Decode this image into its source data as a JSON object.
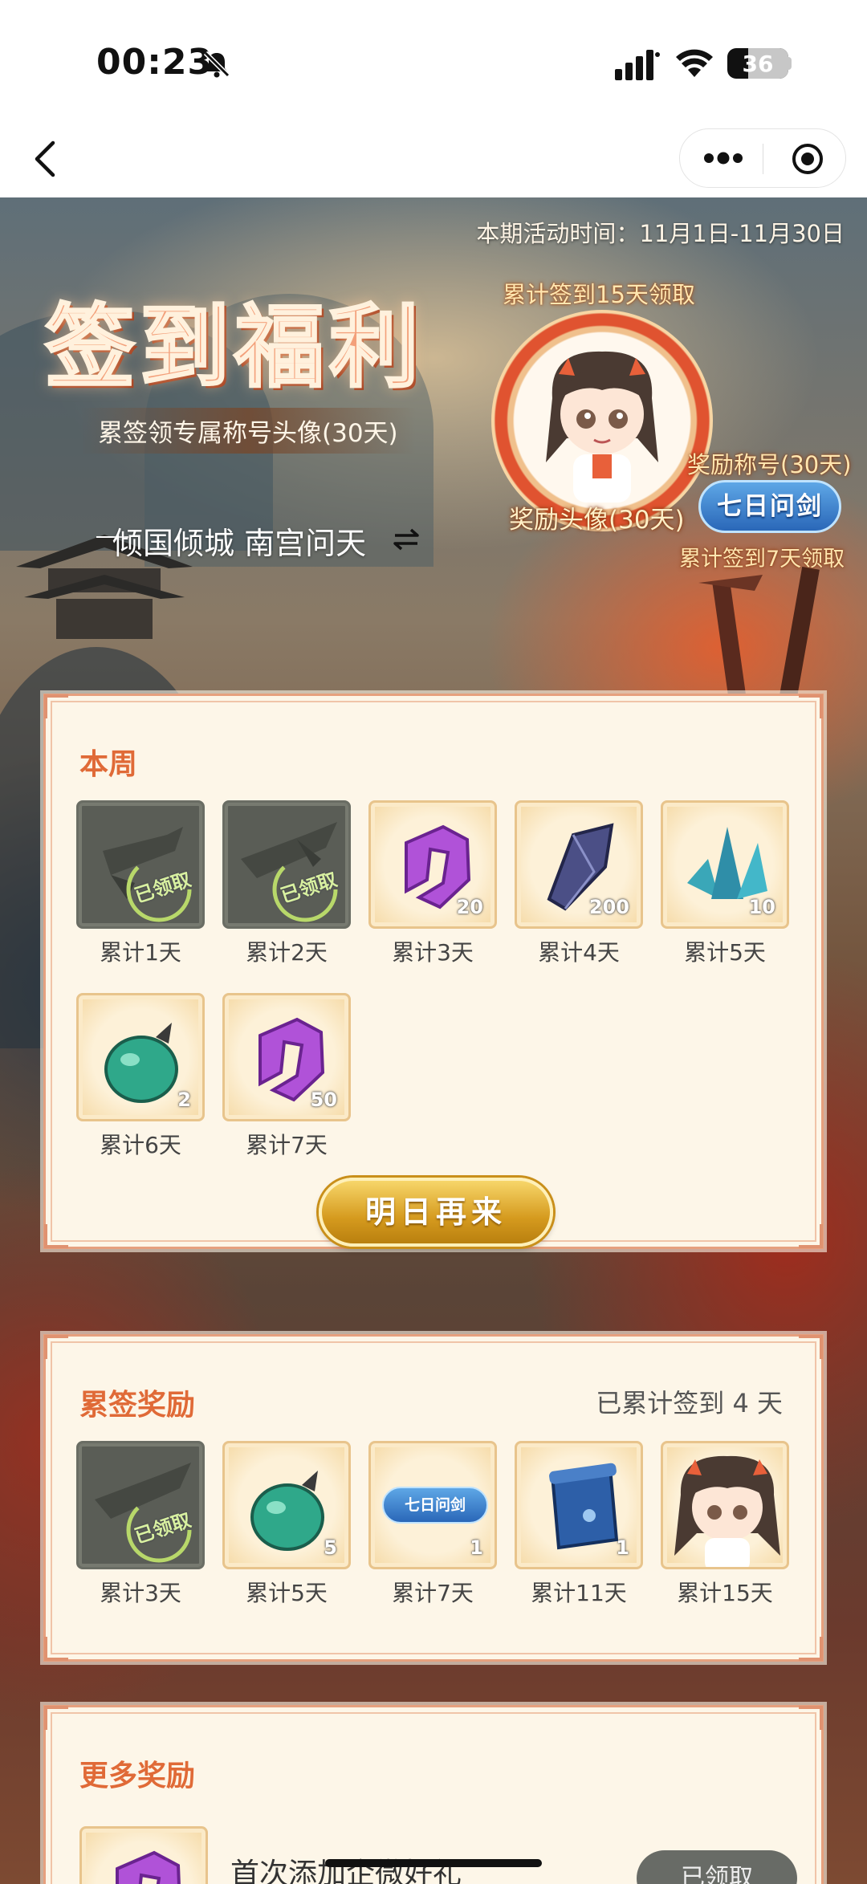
{
  "status_bar": {
    "time": "00:23",
    "battery": "36"
  },
  "banner": {
    "activity_time": "本期活动时间：11月1日-11月30日",
    "title": "签到福利",
    "subtitle": "累签领专属称号头像(30天)",
    "current_title": "倾国倾城 南宫问天",
    "cum15_label": "累计签到15天领取",
    "avatar_label": "奖励头像(30天)",
    "title_reward_label": "奖励称号(30天)",
    "title_badge": "七日问剑",
    "cum7_label": "累计签到7天领取"
  },
  "this_week": {
    "title": "本周",
    "items": [
      {
        "label": "累计1天",
        "claimed": true,
        "stamp": "已领取",
        "icon": "gray-blade-icon"
      },
      {
        "label": "累计2天",
        "claimed": true,
        "stamp": "已领取",
        "icon": "gray-blade-icon"
      },
      {
        "label": "累计3天",
        "claimed": false,
        "qty": "20",
        "icon": "purple-rune-icon"
      },
      {
        "label": "累计4天",
        "claimed": false,
        "qty": "200",
        "icon": "dark-ore-icon"
      },
      {
        "label": "累计5天",
        "claimed": false,
        "qty": "10",
        "icon": "blue-crystal-icon"
      },
      {
        "label": "累计6天",
        "claimed": false,
        "qty": "2",
        "icon": "jade-fruit-icon"
      },
      {
        "label": "累计7天",
        "claimed": false,
        "qty": "50",
        "icon": "purple-rune-icon"
      }
    ],
    "button": "明日再来"
  },
  "cumulative": {
    "title": "累签奖励",
    "summary": "已累计签到 4 天",
    "items": [
      {
        "label": "累计3天",
        "claimed": true,
        "stamp": "已领取",
        "icon": "gray-blade-icon"
      },
      {
        "label": "累计5天",
        "claimed": false,
        "qty": "5",
        "icon": "jade-fruit-icon"
      },
      {
        "label": "累计7天",
        "claimed": false,
        "qty": "1",
        "icon": "title-badge-icon",
        "badge": "七日问剑"
      },
      {
        "label": "累计11天",
        "claimed": false,
        "qty": "1",
        "icon": "blue-scroll-icon"
      },
      {
        "label": "累计15天",
        "claimed": false,
        "icon": "avatar-girl-icon"
      }
    ]
  },
  "more": {
    "title": "更多奖励",
    "item_text": "首次添加企微好礼",
    "button": "已领取"
  },
  "colors": {
    "accent_orange": "#e06a37",
    "panel_bg": "#fdf6e8",
    "gold_button": "#d59a1e",
    "title_blue": "#2a67b8"
  }
}
